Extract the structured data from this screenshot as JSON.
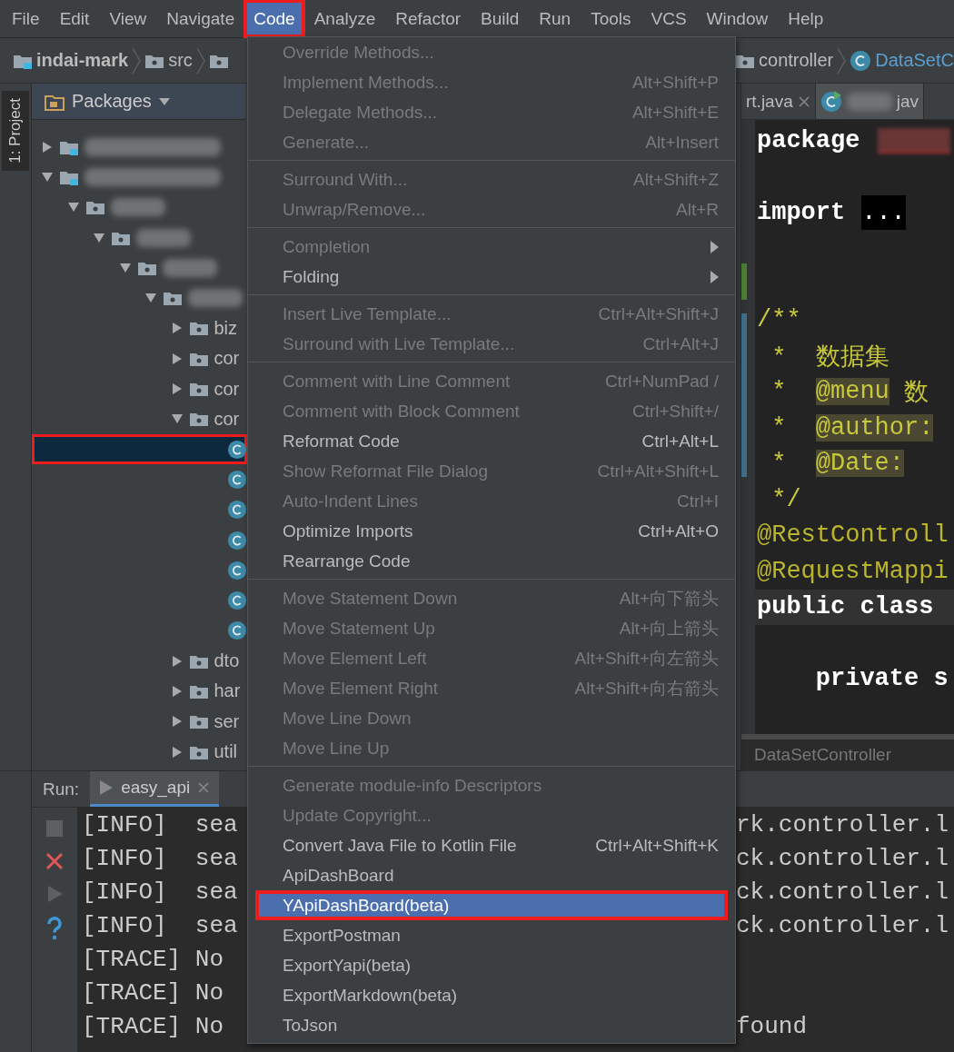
{
  "menubar": [
    {
      "label": "File",
      "selected": false
    },
    {
      "label": "Edit",
      "selected": false
    },
    {
      "label": "View",
      "selected": false
    },
    {
      "label": "Navigate",
      "selected": false
    },
    {
      "label": "Code",
      "selected": true,
      "marked": true
    },
    {
      "label": "Analyze",
      "selected": false
    },
    {
      "label": "Refactor",
      "selected": false
    },
    {
      "label": "Build",
      "selected": false
    },
    {
      "label": "Run",
      "selected": false
    },
    {
      "label": "Tools",
      "selected": false
    },
    {
      "label": "VCS",
      "selected": false
    },
    {
      "label": "Window",
      "selected": false
    },
    {
      "label": "Help",
      "selected": false
    }
  ],
  "breadcrumb": {
    "left": [
      {
        "kind": "module",
        "label": "indai-mark"
      },
      {
        "kind": "folder",
        "label": "src"
      },
      {
        "kind": "folder"
      }
    ],
    "right": [
      {
        "kind": "folder",
        "label": "controller"
      },
      {
        "kind": "class",
        "label": "DataSetC"
      }
    ]
  },
  "tool_strip": {
    "project_tab": "1: Project"
  },
  "project_panel": {
    "title": "Packages",
    "tree": [
      {
        "kind": "module",
        "expanded": false,
        "selected": false
      },
      {
        "kind": "module",
        "expanded": true,
        "selected": false,
        "children": [
          {
            "kind": "folder",
            "expanded": true,
            "selected": false,
            "children": [
              {
                "kind": "folder",
                "expanded": true,
                "selected": false,
                "children": [
                  {
                    "kind": "folder",
                    "expanded": true,
                    "selected": false,
                    "children": [
                      {
                        "kind": "folder",
                        "expanded": true,
                        "selected": false,
                        "children": [
                          {
                            "kind": "folder",
                            "label": "biz",
                            "expanded": false,
                            "selected": false
                          },
                          {
                            "kind": "folder",
                            "label": "cor",
                            "expanded": false,
                            "selected": false
                          },
                          {
                            "kind": "folder",
                            "label": "cor",
                            "expanded": false,
                            "selected": false
                          },
                          {
                            "kind": "folder",
                            "label": "cor",
                            "expanded": true,
                            "selected": false,
                            "children": [
                              {
                                "kind": "class",
                                "selected": true,
                                "marked": true
                              },
                              {
                                "kind": "class",
                                "selected": false
                              },
                              {
                                "kind": "class",
                                "selected": false
                              },
                              {
                                "kind": "class",
                                "selected": false
                              },
                              {
                                "kind": "class",
                                "selected": false
                              },
                              {
                                "kind": "class",
                                "selected": false
                              },
                              {
                                "kind": "class",
                                "selected": false
                              }
                            ]
                          },
                          {
                            "kind": "folder",
                            "label": "dto",
                            "expanded": false,
                            "selected": false
                          },
                          {
                            "kind": "folder",
                            "label": "har",
                            "expanded": false,
                            "selected": false
                          },
                          {
                            "kind": "folder",
                            "label": "ser",
                            "expanded": false,
                            "selected": false
                          },
                          {
                            "kind": "folder",
                            "label": "util",
                            "expanded": false,
                            "selected": false
                          }
                        ]
                      }
                    ]
                  }
                ]
              }
            ]
          }
        ]
      }
    ]
  },
  "editor": {
    "tabs": [
      {
        "label": "rt.java",
        "selected": false,
        "running": false
      },
      {
        "label": "jav",
        "selected": true,
        "running": true
      }
    ],
    "code_lines": [
      {
        "tokens": [
          {
            "kind": "keyword",
            "text": "package"
          },
          {
            "kind": "redacted"
          }
        ]
      },
      {
        "kind": "spaced",
        "tokens": [
          {
            "kind": "keyword",
            "text": "import"
          },
          {
            "kind": "folded",
            "text": "..."
          }
        ]
      },
      {
        "kind": "gapped",
        "tokens": [
          {
            "kind": "doc",
            "text": "/**"
          }
        ]
      },
      {
        "tokens": [
          {
            "kind": "doc",
            "text": " *  数据集"
          }
        ]
      },
      {
        "tokens": [
          {
            "kind": "doc",
            "text": " *  "
          },
          {
            "kind": "doctag",
            "text": "@menu"
          },
          {
            "kind": "doc",
            "text": " 数"
          }
        ]
      },
      {
        "tokens": [
          {
            "kind": "doc",
            "text": " *  "
          },
          {
            "kind": "doctag",
            "text": "@author:"
          }
        ]
      },
      {
        "tokens": [
          {
            "kind": "doc",
            "text": " *  "
          },
          {
            "kind": "doctag",
            "text": "@Date:"
          }
        ]
      },
      {
        "tokens": [
          {
            "kind": "doc",
            "text": " */"
          }
        ]
      },
      {
        "tokens": [
          {
            "kind": "annotation",
            "text": "@RestControll"
          }
        ]
      },
      {
        "tokens": [
          {
            "kind": "annotation",
            "text": "@RequestMappi"
          }
        ]
      },
      {
        "current": true,
        "tokens": [
          {
            "kind": "keyword",
            "text": "public class"
          }
        ]
      },
      {
        "kind": "spaced",
        "tokens": [
          {
            "kind": "keyword",
            "text": "    private s"
          }
        ]
      }
    ],
    "status": "DataSetController"
  },
  "run_panel": {
    "title": "Run:",
    "tabs": [
      {
        "label": "easy_api",
        "selected": true
      }
    ],
    "lines": [
      {
        "left": "[INFO]  sea",
        "right": "rk.controller.l"
      },
      {
        "left": "[INFO]  sea",
        "right": "ck.controller.l"
      },
      {
        "left": "[INFO]  sea",
        "right": "ck.controller.l"
      },
      {
        "left": "[INFO]  sea",
        "right": "ck.controller.l"
      },
      {
        "left": "[TRACE] No"
      },
      {
        "left": "[TRACE] No"
      },
      {
        "left": "[TRACE] No",
        "right": "found"
      }
    ]
  },
  "menu": {
    "groups": [
      [
        {
          "label": "Override Methods...",
          "disabled": true,
          "selected": false
        },
        {
          "label": "Implement Methods...",
          "shortcut": "Alt+Shift+P",
          "disabled": true,
          "selected": false
        },
        {
          "label": "Delegate Methods...",
          "shortcut": "Alt+Shift+E",
          "disabled": true,
          "selected": false
        },
        {
          "label": "Generate...",
          "shortcut": "Alt+Insert",
          "disabled": true,
          "selected": false
        }
      ],
      [
        {
          "label": "Surround With...",
          "shortcut": "Alt+Shift+Z",
          "disabled": true,
          "selected": false
        },
        {
          "label": "Unwrap/Remove...",
          "shortcut": "Alt+R",
          "disabled": true,
          "selected": false
        }
      ],
      [
        {
          "label": "Completion",
          "disabled": true,
          "submenu": true,
          "selected": false
        },
        {
          "label": "Folding",
          "disabled": false,
          "submenu": true,
          "selected": false
        }
      ],
      [
        {
          "label": "Insert Live Template...",
          "shortcut": "Ctrl+Alt+Shift+J",
          "disabled": true,
          "selected": false
        },
        {
          "label": "Surround with Live Template...",
          "shortcut": "Ctrl+Alt+J",
          "disabled": true,
          "selected": false
        }
      ],
      [
        {
          "label": "Comment with Line Comment",
          "shortcut": "Ctrl+NumPad /",
          "disabled": true,
          "selected": false
        },
        {
          "label": "Comment with Block Comment",
          "shortcut": "Ctrl+Shift+/",
          "disabled": true,
          "selected": false
        },
        {
          "label": "Reformat Code",
          "shortcut": "Ctrl+Alt+L",
          "disabled": false,
          "selected": false
        },
        {
          "label": "Show Reformat File Dialog",
          "shortcut": "Ctrl+Alt+Shift+L",
          "disabled": true,
          "selected": false
        },
        {
          "label": "Auto-Indent Lines",
          "shortcut": "Ctrl+I",
          "disabled": true,
          "selected": false
        },
        {
          "label": "Optimize Imports",
          "shortcut": "Ctrl+Alt+O",
          "disabled": false,
          "selected": false
        },
        {
          "label": "Rearrange Code",
          "disabled": false,
          "selected": false
        }
      ],
      [
        {
          "label": "Move Statement Down",
          "shortcut": "Alt+向下箭头",
          "disabled": true,
          "selected": false
        },
        {
          "label": "Move Statement Up",
          "shortcut": "Alt+向上箭头",
          "disabled": true,
          "selected": false
        },
        {
          "label": "Move Element Left",
          "shortcut": "Alt+Shift+向左箭头",
          "disabled": true,
          "selected": false
        },
        {
          "label": "Move Element Right",
          "shortcut": "Alt+Shift+向右箭头",
          "disabled": true,
          "selected": false
        },
        {
          "label": "Move Line Down",
          "disabled": true,
          "selected": false
        },
        {
          "label": "Move Line Up",
          "disabled": true,
          "selected": false
        }
      ],
      [
        {
          "label": "Generate module-info Descriptors",
          "disabled": true,
          "selected": false
        },
        {
          "label": "Update Copyright...",
          "disabled": true,
          "selected": false
        },
        {
          "label": "Convert Java File to Kotlin File",
          "shortcut": "Ctrl+Alt+Shift+K",
          "disabled": false,
          "selected": false
        },
        {
          "label": "ApiDashBoard",
          "disabled": false,
          "selected": false
        },
        {
          "label": "YApiDashBoard(beta)",
          "disabled": false,
          "selected": true,
          "marked": true
        },
        {
          "label": "ExportPostman",
          "disabled": false,
          "selected": false
        },
        {
          "label": "ExportYapi(beta)",
          "disabled": false,
          "selected": false
        },
        {
          "label": "ExportMarkdown(beta)",
          "disabled": false,
          "selected": false
        },
        {
          "label": "ToJson",
          "disabled": false,
          "selected": false
        }
      ]
    ]
  }
}
